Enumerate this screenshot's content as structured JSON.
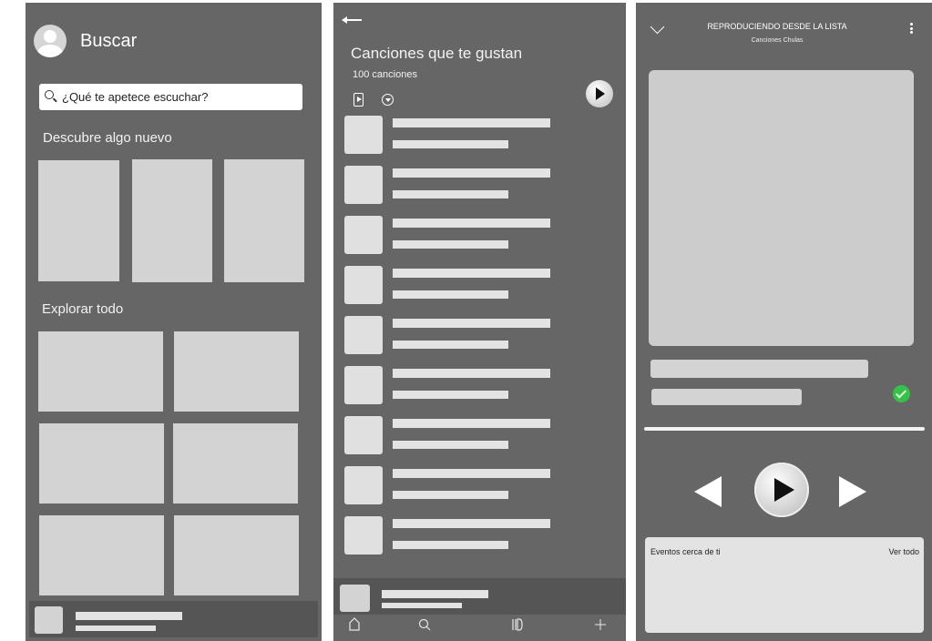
{
  "search_screen": {
    "title": "Buscar",
    "search_placeholder": "¿Qué te apetece escuchar?",
    "section_discover": "Descubre algo nuevo",
    "section_explore": "Explorar todo"
  },
  "liked_songs_screen": {
    "title": "Canciones que te gustan",
    "count": "100 canciones",
    "song_count_rows": 9
  },
  "now_playing_screen": {
    "header": "REPRODUCIENDO DESDE LA LISTA",
    "playlist": "Canciones Chulas",
    "events_title": "Eventos cerca de ti",
    "events_link": "Ver todo",
    "liked": true
  },
  "colors": {
    "panel_bg": "#666666",
    "placeholder": "#d3d3d3",
    "accent_green": "#39c04c"
  },
  "icons": {
    "back": "arrow-left-icon",
    "collapse": "chevron-down-icon",
    "menu": "kebab-menu-icon",
    "nav": [
      "home-icon",
      "search-icon",
      "library-icon",
      "add-icon"
    ]
  }
}
